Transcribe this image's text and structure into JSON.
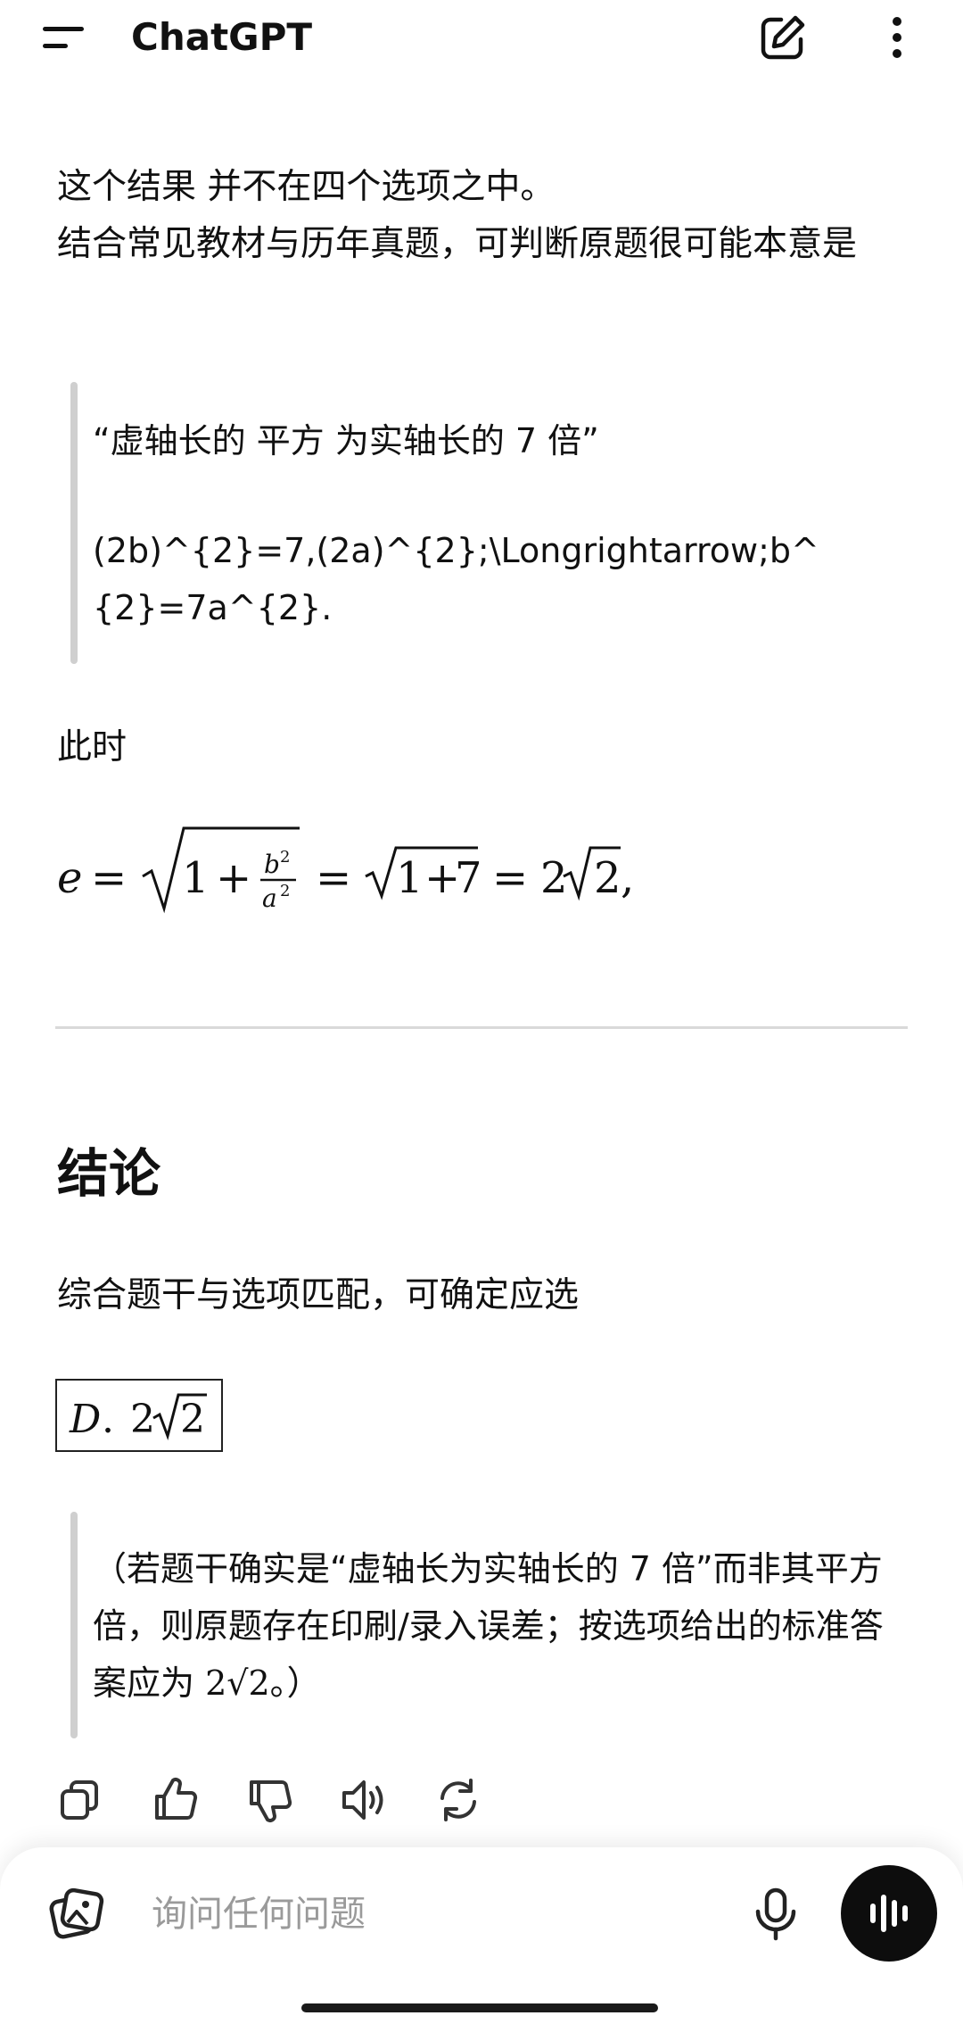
{
  "header": {
    "title": "ChatGPT",
    "menu_icon": "hamburger-menu-icon",
    "new_chat_icon": "edit-pencil-icon",
    "more_icon": "vertical-dots-icon"
  },
  "message": {
    "intro_line1": "这个结果 并不在四个选项之中。",
    "intro_line2": "结合常见教材与历年真题，可判断原题很可能本意是",
    "quote1_line1": "“虚轴长的 平方 为实轴长的 7 倍”",
    "quote1_line2": "(2b)^{2}=7,(2a)^{2};\\Longrightarrow;b^{2}=7a^{2}.",
    "ci_shi": "此时",
    "formula": "e = √(1 + b²/a²) = √(1+7) = 2√2,",
    "heading": "结论",
    "conclusion": "综合题干与选项匹配，可确定应选",
    "boxed_answer": "D. 2√2",
    "quote2_part1": "（若题干确实是“虚轴长为实轴长的 7 倍”而非其平方倍，则原题存在印刷/录入误差；按选项给出的标准答案应为 ",
    "quote2_math": "2√2",
    "quote2_part2": "。）"
  },
  "actions": [
    "copy-icon",
    "thumbs-up-icon",
    "thumbs-down-icon",
    "read-aloud-icon",
    "regenerate-icon"
  ],
  "composer": {
    "placeholder": "询问任何问题",
    "value": ""
  },
  "colors": {
    "background": "#ffffff",
    "text": "#111111",
    "quote_bar": "#cfcfcf",
    "divider": "#d9d9d9",
    "voice_button": "#0d0d0d"
  }
}
